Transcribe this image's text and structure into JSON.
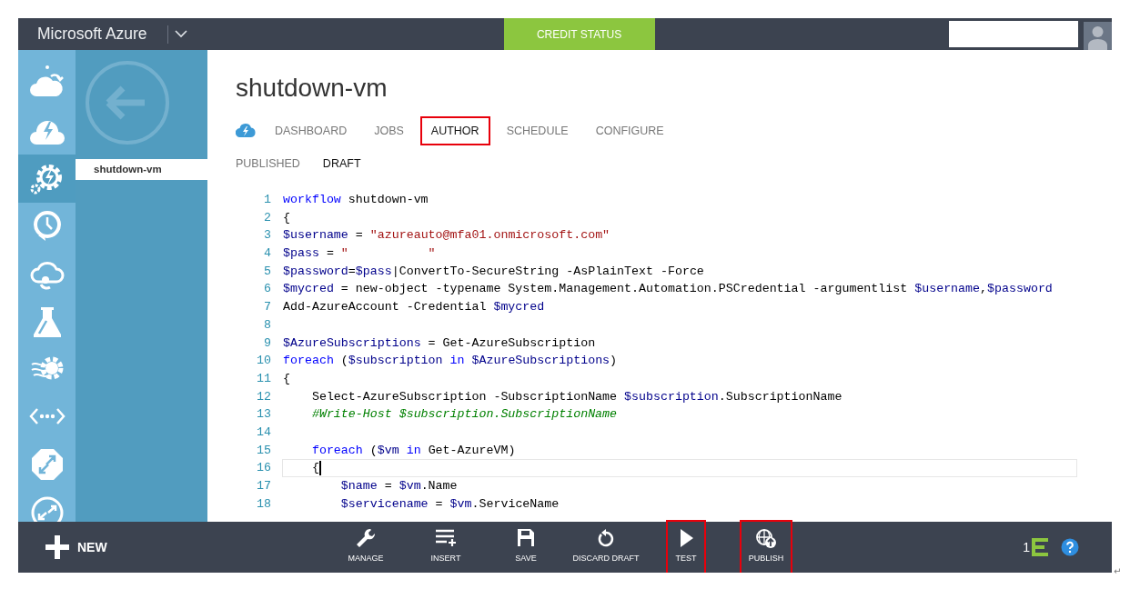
{
  "top_bar": {
    "brand": "Microsoft Azure",
    "credit_button": "CREDIT STATUS"
  },
  "sidebar": {
    "nav_icons": [
      {
        "kind": "cloud-arrow",
        "selected": false
      },
      {
        "kind": "cloud-bolt",
        "selected": false
      },
      {
        "kind": "gear-bolt",
        "selected": true
      },
      {
        "kind": "clock",
        "selected": false
      },
      {
        "kind": "cloud-ring",
        "selected": false
      },
      {
        "kind": "flask",
        "selected": false
      },
      {
        "kind": "gear-waves",
        "selected": false
      },
      {
        "kind": "code",
        "selected": false
      },
      {
        "kind": "octagon-arrows",
        "selected": false
      },
      {
        "kind": "circle-arrows",
        "selected": false
      }
    ],
    "items": [
      {
        "label": "shutdown-vm",
        "selected": true
      }
    ]
  },
  "page": {
    "title": "shutdown-vm",
    "tabs": [
      {
        "label": "DASHBOARD",
        "selected": false,
        "highlighted": false
      },
      {
        "label": "JOBS",
        "selected": false,
        "highlighted": false
      },
      {
        "label": "AUTHOR",
        "selected": true,
        "highlighted": true
      },
      {
        "label": "SCHEDULE",
        "selected": false,
        "highlighted": false
      },
      {
        "label": "CONFIGURE",
        "selected": false,
        "highlighted": false
      }
    ],
    "subtabs": [
      {
        "label": "PUBLISHED",
        "selected": false
      },
      {
        "label": "DRAFT",
        "selected": true
      }
    ]
  },
  "code": {
    "lines": [
      {
        "number": "1",
        "current": false,
        "tokens": [
          {
            "kind": "keyword",
            "text": "workflow"
          },
          {
            "kind": "plain",
            "text": " shutdown-vm"
          }
        ]
      },
      {
        "number": "2",
        "current": false,
        "tokens": [
          {
            "kind": "plain",
            "text": "{"
          }
        ]
      },
      {
        "number": "3",
        "current": false,
        "tokens": [
          {
            "kind": "variable",
            "text": "$username"
          },
          {
            "kind": "plain",
            "text": " = "
          },
          {
            "kind": "string",
            "text": "\"azureauto@mfa01.onmicrosoft.com\""
          }
        ]
      },
      {
        "number": "4",
        "current": false,
        "tokens": [
          {
            "kind": "variable",
            "text": "$pass"
          },
          {
            "kind": "plain",
            "text": " = "
          },
          {
            "kind": "string",
            "text": "\"           \""
          }
        ]
      },
      {
        "number": "5",
        "current": false,
        "tokens": [
          {
            "kind": "variable",
            "text": "$password"
          },
          {
            "kind": "plain",
            "text": "="
          },
          {
            "kind": "variable",
            "text": "$pass"
          },
          {
            "kind": "plain",
            "text": "|ConvertTo-SecureString -AsPlainText -Force"
          }
        ]
      },
      {
        "number": "6",
        "current": false,
        "tokens": [
          {
            "kind": "variable",
            "text": "$mycred"
          },
          {
            "kind": "plain",
            "text": " = new-object -typename System.Management.Automation.PSCredential -argumentlist "
          },
          {
            "kind": "variable",
            "text": "$username"
          },
          {
            "kind": "plain",
            "text": ","
          },
          {
            "kind": "variable",
            "text": "$password"
          }
        ]
      },
      {
        "number": "7",
        "current": false,
        "tokens": [
          {
            "kind": "plain",
            "text": "Add-AzureAccount -Credential "
          },
          {
            "kind": "variable",
            "text": "$mycred"
          }
        ]
      },
      {
        "number": "8",
        "current": false
      },
      {
        "number": "9",
        "current": false,
        "tokens": [
          {
            "kind": "variable",
            "text": "$AzureSubscriptions"
          },
          {
            "kind": "plain",
            "text": " = Get-AzureSubscription"
          }
        ]
      },
      {
        "number": "10",
        "current": false,
        "tokens": [
          {
            "kind": "keyword",
            "text": "foreach"
          },
          {
            "kind": "plain",
            "text": " ("
          },
          {
            "kind": "variable",
            "text": "$subscription"
          },
          {
            "kind": "keyword",
            "text": " in"
          },
          {
            "kind": "variable",
            "text": " $AzureSubscriptions"
          },
          {
            "kind": "plain",
            "text": ")"
          }
        ]
      },
      {
        "number": "11",
        "current": false,
        "tokens": [
          {
            "kind": "plain",
            "text": "{"
          }
        ]
      },
      {
        "number": "12",
        "current": false,
        "tokens": [
          {
            "kind": "plain",
            "text": "    Select-AzureSubscription -SubscriptionName "
          },
          {
            "kind": "variable",
            "text": "$subscription"
          },
          {
            "kind": "plain",
            "text": ".SubscriptionName"
          }
        ]
      },
      {
        "number": "13",
        "current": false,
        "tokens": [
          {
            "kind": "comment",
            "text": "    #Write-Host $subscription.SubscriptionName"
          }
        ]
      },
      {
        "number": "14",
        "current": false
      },
      {
        "number": "15",
        "current": false,
        "tokens": [
          {
            "kind": "keyword",
            "text": "    foreach"
          },
          {
            "kind": "plain",
            "text": " ("
          },
          {
            "kind": "variable",
            "text": "$vm"
          },
          {
            "kind": "keyword",
            "text": " in"
          },
          {
            "kind": "plain",
            "text": " Get-AzureVM)"
          }
        ]
      },
      {
        "number": "16",
        "current": true,
        "tokens": [
          {
            "kind": "plain",
            "text": "    {"
          }
        ]
      },
      {
        "number": "17",
        "current": false,
        "tokens": [
          {
            "kind": "variable",
            "text": "        $name"
          },
          {
            "kind": "plain",
            "text": " = "
          },
          {
            "kind": "variable",
            "text": "$vm"
          },
          {
            "kind": "plain",
            "text": ".Name"
          }
        ]
      },
      {
        "number": "18",
        "current": false,
        "tokens": [
          {
            "kind": "variable",
            "text": "        $servicename"
          },
          {
            "kind": "plain",
            "text": " = "
          },
          {
            "kind": "variable",
            "text": "$vm"
          },
          {
            "kind": "plain",
            "text": ".ServiceName"
          }
        ]
      }
    ]
  },
  "bottom_bar": {
    "new_button": "NEW",
    "actions": [
      {
        "kind": "manage",
        "label": "MANAGE",
        "highlighted": false
      },
      {
        "kind": "insert",
        "label": "INSERT",
        "highlighted": false
      },
      {
        "kind": "save",
        "label": "SAVE",
        "highlighted": false
      },
      {
        "kind": "discard",
        "label": "DISCARD DRAFT",
        "highlighted": false
      },
      {
        "kind": "test",
        "label": "TEST",
        "highlighted": true
      },
      {
        "kind": "publish",
        "label": "PUBLISH",
        "highlighted": true
      }
    ],
    "notification_count": "1"
  },
  "return_mark": "↵"
}
